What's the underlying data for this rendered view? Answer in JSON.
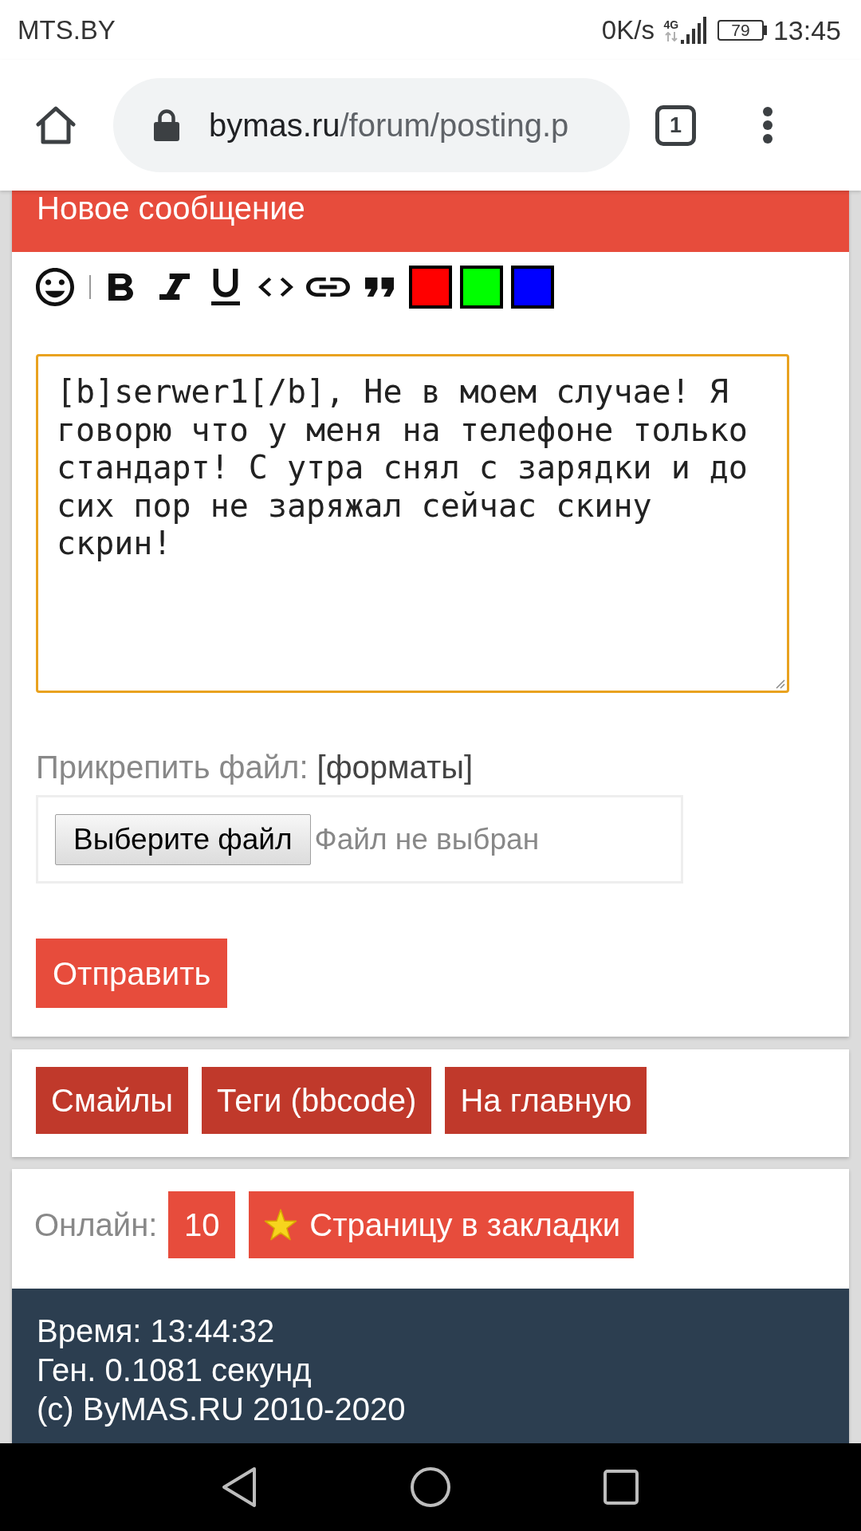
{
  "status_bar": {
    "carrier": "MTS.BY",
    "speed": "0K/s",
    "network": "4G",
    "battery": "79",
    "time": "13:45"
  },
  "browser": {
    "domain": "bymas.ru",
    "path": "/forum/posting.p",
    "tab_count": "1"
  },
  "new_post": {
    "title": "Новое сообщение",
    "color_buttons": [
      {
        "color": "#ff0000"
      },
      {
        "color": "#00ff00"
      },
      {
        "color": "#0000ff"
      }
    ],
    "message": "[b]serwer1[/b], Не в моем случае! Я говорю что у меня на телефоне только стандарт! С утра снял с зарядки и до сих пор не заряжал сейчас скину скрин!",
    "attach_label": "Прикрепить файл:",
    "formats_link": "[форматы]",
    "file_button": "Выберите файл",
    "file_status": "Файл не выбран",
    "submit": "Отправить"
  },
  "links": [
    "Смайлы",
    "Теги (bbcode)",
    "На главную"
  ],
  "online": {
    "label": "Онлайн:",
    "count": "10",
    "bookmark": "Страницу в закладки"
  },
  "footer": [
    "Время: 13:44:32",
    "Ген. 0.1081 секунд",
    "(c) ByMAS.RU 2010-2020"
  ]
}
